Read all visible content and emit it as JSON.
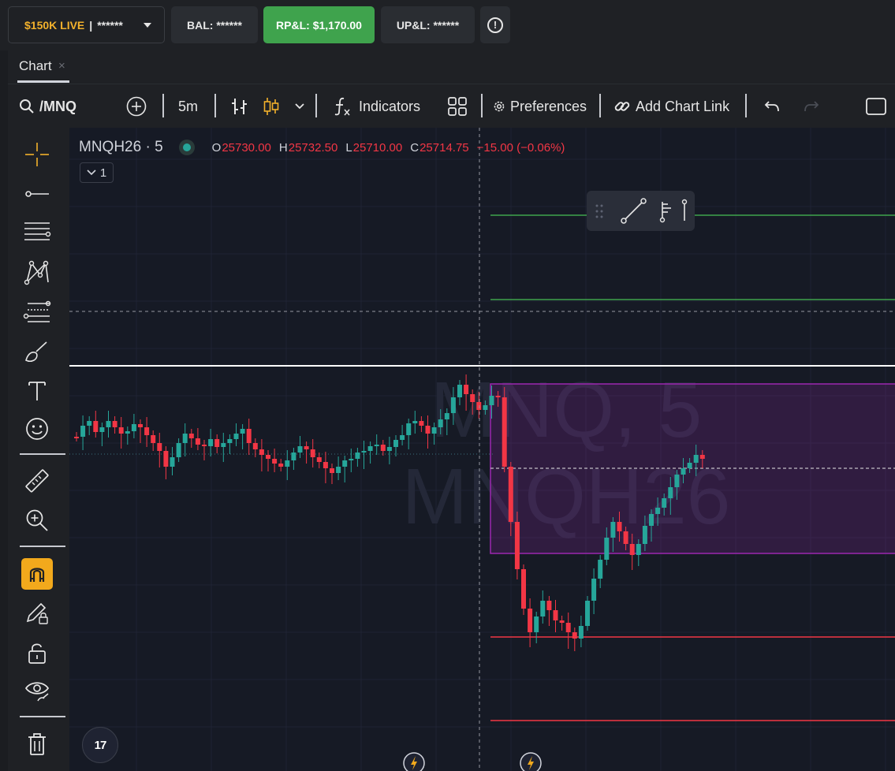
{
  "account": {
    "name": "$150K LIVE",
    "separator": "|",
    "masked_id": "******",
    "balance_label": "BAL:",
    "balance_value": "******",
    "rpl_label": "RP&L:",
    "rpl_value": "$1,170.00",
    "upl_label": "UP&L:",
    "upl_value": "******"
  },
  "tabs": [
    {
      "label": "Chart",
      "close": "×"
    }
  ],
  "toolbar": {
    "symbol": "/MNQ",
    "interval": "5m",
    "indicators_label": "Indicators",
    "preferences_label": "Preferences",
    "chart_link_label": "Add Chart Link"
  },
  "legend": {
    "symbol": "MNQH26 · 5",
    "open_key": "O",
    "open": "25730.00",
    "high_key": "H",
    "high": "25732.50",
    "low_key": "L",
    "low": "25710.00",
    "close_key": "C",
    "close": "25714.75",
    "change": "−15.00 (−0.06%)",
    "collapse_count": "1"
  },
  "watermark": {
    "line1": "MNQ, 5",
    "line2": "MNQH26"
  },
  "logo_text": "17",
  "colors": {
    "up": "#26a69a",
    "down": "#f23645",
    "target_line": "#3fa34d",
    "stop_line": "#f23645",
    "range_box": "#9c27b0",
    "accent": "#f2b12c",
    "profit_button": "#3fa34d"
  },
  "icons": [
    "crosshair-icon",
    "trend-line-icon",
    "parallel-lines-icon",
    "pattern-icon",
    "fib-icon",
    "brush-icon",
    "text-icon",
    "emoji-icon",
    "ruler-icon",
    "zoom-in-icon",
    "magnet-icon",
    "pencil-lock-icon",
    "lock-icon",
    "eye-icon",
    "trash-icon",
    "undo-icon",
    "redo-icon",
    "search-icon",
    "add-icon",
    "bar-type-icon",
    "candle-type-icon",
    "function-icon",
    "layout-icon",
    "gear-icon",
    "link-icon",
    "lightning-icon"
  ]
}
